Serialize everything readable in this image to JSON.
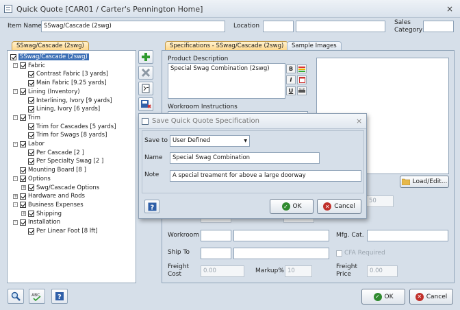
{
  "window": {
    "title": "Quick Quote [CAR01 / Carter's Pennington Home]",
    "close_glyph": "×"
  },
  "header": {
    "item_name_label": "Item Name",
    "item_name_value": "SSwag/Cascade (2swg)",
    "location_label": "Location",
    "sales_category_label_1": "Sales",
    "sales_category_label_2": "Category"
  },
  "tree": {
    "tab_label": "SSwag/Cascade (2swg)",
    "rows": [
      {
        "text": "SSwag/Cascade (2swg)",
        "level": 0,
        "toggle": "",
        "selected": true
      },
      {
        "text": "Fabric",
        "level": 1,
        "toggle": "-"
      },
      {
        "text": "Contrast Fabric [3 yards]",
        "level": 2,
        "toggle": ""
      },
      {
        "text": "Main Fabric [9.25 yards]",
        "level": 2,
        "toggle": ""
      },
      {
        "text": "Lining (Inventory)",
        "level": 1,
        "toggle": "-"
      },
      {
        "text": "Interlining, Ivory [9 yards]",
        "level": 2,
        "toggle": ""
      },
      {
        "text": "Lining, Ivory [6 yards]",
        "level": 2,
        "toggle": ""
      },
      {
        "text": "Trim",
        "level": 1,
        "toggle": "-"
      },
      {
        "text": "Trim for Cascades [5 yards]",
        "level": 2,
        "toggle": ""
      },
      {
        "text": "Trim for Swags [8 yards]",
        "level": 2,
        "toggle": ""
      },
      {
        "text": "Labor",
        "level": 1,
        "toggle": "-"
      },
      {
        "text": "Per Cascade [2 ]",
        "level": 2,
        "toggle": ""
      },
      {
        "text": "Per Specialty Swag [2 ]",
        "level": 2,
        "toggle": ""
      },
      {
        "text": "Mounting Board [8 ]",
        "level": 1,
        "toggle": ""
      },
      {
        "text": "Options",
        "level": 1,
        "toggle": "-"
      },
      {
        "text": "Swg/Cascade Options",
        "level": 2,
        "toggle": "+"
      },
      {
        "text": "Hardware and Rods",
        "level": 1,
        "toggle": "+"
      },
      {
        "text": "Business Expenses",
        "level": 1,
        "toggle": "-"
      },
      {
        "text": "Shipping",
        "level": 2,
        "toggle": "+"
      },
      {
        "text": "Installation",
        "level": 1,
        "toggle": "-"
      },
      {
        "text": "Per Linear Foot [8 lft]",
        "level": 2,
        "toggle": ""
      }
    ]
  },
  "toolbar": {
    "add_icon": "plus-icon",
    "delete_icon": "x-icon",
    "calc_icon": "calculator-icon",
    "save_spec_icon": "save-spec-icon"
  },
  "spec": {
    "tab_specifications": "Specifications - SSwag/Cascade (2swg)",
    "tab_sample_images": "Sample Images",
    "product_description_label": "Product Description",
    "product_description_value": "Special Swag Combination (2swg)",
    "workroom_instructions_label": "Workroom Instructions",
    "load_edit_label": "Load/Edit...",
    "partial_value": "50",
    "workroom_label": "Workroom",
    "mfg_cat_label": "Mfg. Cat.",
    "ship_to_label": "Ship To",
    "cfa_required_label": "CFA Required",
    "freight_cost_label_1": "Freight",
    "freight_cost_label_2": "Cost",
    "freight_cost_value": "0.00",
    "markup_label": "Markup%",
    "markup_value": "10",
    "freight_price_label_1": "Freight",
    "freight_price_label_2": "Price",
    "freight_price_value": "0.00"
  },
  "dialog": {
    "title": "Save Quick Quote Specification",
    "close_glyph": "×",
    "save_to_label": "Save to",
    "save_to_value": "User Defined",
    "name_label": "Name",
    "name_value": "Special Swag Combination",
    "note_label": "Note",
    "note_value": "A special treament for above a large doorway",
    "help_label": "?",
    "ok_label": "OK",
    "cancel_label": "Cancel"
  },
  "footer": {
    "ok_label": "OK",
    "cancel_label": "Cancel",
    "help_label": "?"
  }
}
